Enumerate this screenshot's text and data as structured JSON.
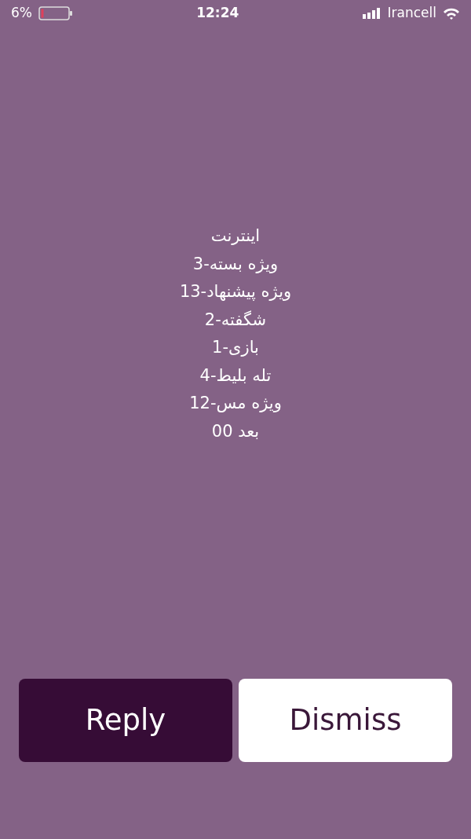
{
  "status_bar": {
    "carrier": "Irancell",
    "time": "12:24",
    "battery": "6%"
  },
  "message": {
    "lines": [
      "اینترنت",
      "ویژه بسته-3",
      "ویژه پیشنهاد-13",
      "شگفته-2",
      "بازی-1",
      "تله بلیط-4",
      "ویژه مس-12",
      "بعد 00"
    ]
  },
  "buttons": [
    {
      "label": "Dismiss",
      "kind": "secondary"
    },
    {
      "label": "Reply",
      "kind": "primary"
    }
  ]
}
